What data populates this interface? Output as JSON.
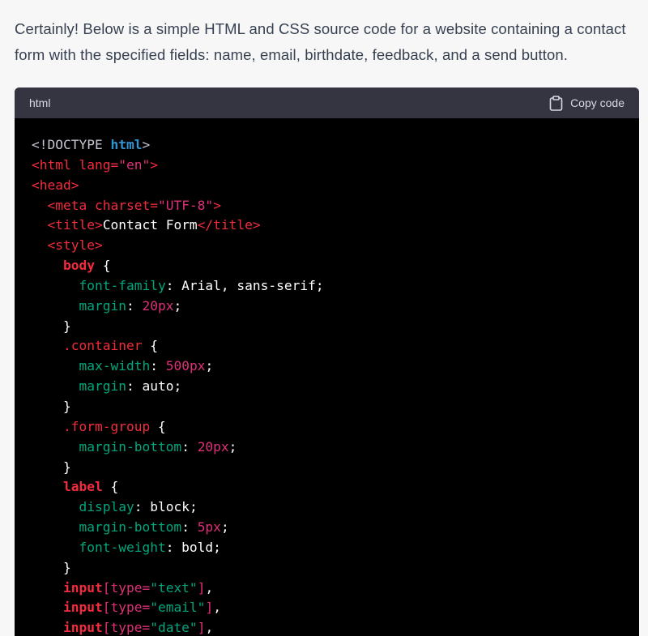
{
  "message": {
    "intro_text": "Certainly! Below is a simple HTML and CSS source code for a website containing a contact form with the specified fields: name, email, birthdate, feedback, and a send button."
  },
  "code_block": {
    "language": "html",
    "copy_label": "Copy code",
    "copy_icon": "clipboard-icon",
    "lines": [
      [
        [
          "doctype",
          "<!DOCTYPE "
        ],
        [
          "tag-blue",
          "html"
        ],
        [
          "doctype",
          ">"
        ]
      ],
      [
        [
          "tag",
          "<html "
        ],
        [
          "tag",
          "lang="
        ],
        [
          "str-red",
          "\"en\""
        ],
        [
          "tag",
          ">"
        ]
      ],
      [
        [
          "tag",
          "<head>"
        ]
      ],
      [
        [
          "plain",
          "  "
        ],
        [
          "tag",
          "<meta "
        ],
        [
          "tag",
          "charset="
        ],
        [
          "str-red",
          "\"UTF-8\""
        ],
        [
          "tag",
          ">"
        ]
      ],
      [
        [
          "plain",
          "  "
        ],
        [
          "tag",
          "<title>"
        ],
        [
          "plain",
          "Contact Form"
        ],
        [
          "tag",
          "</title>"
        ]
      ],
      [
        [
          "plain",
          "  "
        ],
        [
          "tag",
          "<style>"
        ]
      ],
      [
        [
          "plain",
          "    "
        ],
        [
          "sel",
          "body"
        ],
        [
          "plain",
          " {"
        ]
      ],
      [
        [
          "plain",
          "      "
        ],
        [
          "prop",
          "font-family"
        ],
        [
          "plain",
          ": Arial, sans-serif;"
        ]
      ],
      [
        [
          "plain",
          "      "
        ],
        [
          "prop",
          "margin"
        ],
        [
          "plain",
          ": "
        ],
        [
          "num",
          "20px"
        ],
        [
          "plain",
          ";"
        ]
      ],
      [
        [
          "plain",
          "    }"
        ]
      ],
      [
        [
          "plain",
          "    "
        ],
        [
          "class",
          ".container"
        ],
        [
          "plain",
          " {"
        ]
      ],
      [
        [
          "plain",
          "      "
        ],
        [
          "prop",
          "max-width"
        ],
        [
          "plain",
          ": "
        ],
        [
          "num",
          "500px"
        ],
        [
          "plain",
          ";"
        ]
      ],
      [
        [
          "plain",
          "      "
        ],
        [
          "prop",
          "margin"
        ],
        [
          "plain",
          ": auto;"
        ]
      ],
      [
        [
          "plain",
          "    }"
        ]
      ],
      [
        [
          "plain",
          "    "
        ],
        [
          "class",
          ".form-group"
        ],
        [
          "plain",
          " {"
        ]
      ],
      [
        [
          "plain",
          "      "
        ],
        [
          "prop",
          "margin-bottom"
        ],
        [
          "plain",
          ": "
        ],
        [
          "num",
          "20px"
        ],
        [
          "plain",
          ";"
        ]
      ],
      [
        [
          "plain",
          "    }"
        ]
      ],
      [
        [
          "plain",
          "    "
        ],
        [
          "sel",
          "label"
        ],
        [
          "plain",
          " {"
        ]
      ],
      [
        [
          "plain",
          "      "
        ],
        [
          "prop",
          "display"
        ],
        [
          "plain",
          ": block;"
        ]
      ],
      [
        [
          "plain",
          "      "
        ],
        [
          "prop",
          "margin-bottom"
        ],
        [
          "plain",
          ": "
        ],
        [
          "num",
          "5px"
        ],
        [
          "plain",
          ";"
        ]
      ],
      [
        [
          "plain",
          "      "
        ],
        [
          "prop",
          "font-weight"
        ],
        [
          "plain",
          ": bold;"
        ]
      ],
      [
        [
          "plain",
          "    }"
        ]
      ],
      [
        [
          "plain",
          "    "
        ],
        [
          "sel",
          "input"
        ],
        [
          "attr-sel",
          "[type="
        ],
        [
          "attr-str",
          "\"text\""
        ],
        [
          "attr-sel",
          "]"
        ],
        [
          "plain",
          ","
        ]
      ],
      [
        [
          "plain",
          "    "
        ],
        [
          "sel",
          "input"
        ],
        [
          "attr-sel",
          "[type="
        ],
        [
          "attr-str",
          "\"email\""
        ],
        [
          "attr-sel",
          "]"
        ],
        [
          "plain",
          ","
        ]
      ],
      [
        [
          "plain",
          "    "
        ],
        [
          "sel",
          "input"
        ],
        [
          "attr-sel",
          "[type="
        ],
        [
          "attr-str",
          "\"date\""
        ],
        [
          "attr-sel",
          "]"
        ],
        [
          "plain",
          ","
        ]
      ]
    ]
  },
  "colors": {
    "page_background": "#f7f7f8",
    "text": "#374151",
    "code_header_bg": "#343541",
    "code_bg": "#000000",
    "tag": "#f22c3d",
    "keyword_blue": "#2e95d3",
    "property": "#00a67d",
    "number": "#df3079"
  }
}
